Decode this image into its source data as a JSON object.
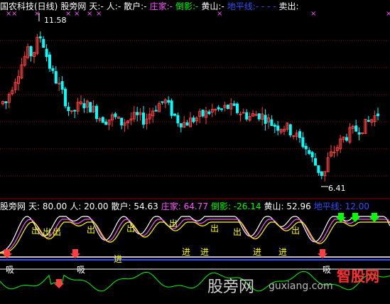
{
  "top_panel": {
    "title": "国农科技(日线)",
    "ind_name": "股旁网",
    "tian": "天:",
    "tian_val": "-",
    "ren": "人:",
    "ren_val": "-",
    "sanhu": "散户:",
    "sanhu_val": "-",
    "zhuangjia": "庄家:",
    "zhuangjia_val": "-",
    "daoying": "倒影:",
    "daoying_val": "-",
    "huangshan": "黄山:",
    "huangshan_val": "-",
    "dipingxian": "地平线:",
    "dipingxian_val": "- - - -",
    "maichu": "卖出:",
    "high_label": "11.58",
    "low_label": "6.41"
  },
  "bottom_panel": {
    "ind_name": "股旁网",
    "tian": "天:",
    "tian_val": "80.00",
    "ren": "人:",
    "ren_val": "20.00",
    "sanhu": "散户:",
    "sanhu_val": "54.63",
    "zhuangjia": "庄家:",
    "zhuangjia_val": "64.77",
    "daoying": "倒影:",
    "daoying_val": "-26.14",
    "huangshan": "黄山:",
    "huangshan_val": "52.96",
    "dipingxian": "地平线:",
    "dipingxian_val": "12.00",
    "chu": "出",
    "jin": "进",
    "xi": "吸"
  },
  "watermark": {
    "text1": "股旁网",
    "text2": "guxiang.com",
    "logo": "智股网"
  },
  "colors": {
    "up": "#ff4040",
    "down": "#00ffff",
    "grid": "#8b0000",
    "white": "#ffffff",
    "yellow": "#ffff00",
    "magenta": "#ff55ff",
    "green": "#00ff00",
    "blue": "#3050ff"
  }
}
